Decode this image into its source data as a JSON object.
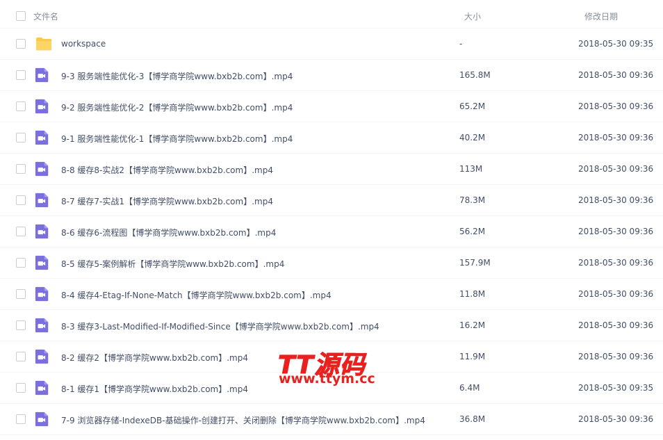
{
  "header": {
    "name_label": "文件名",
    "size_label": "大小",
    "date_label": "修改日期"
  },
  "files": [
    {
      "name": "workspace",
      "size": "-",
      "date": "2018-05-30 09:35",
      "type": "folder-icon"
    },
    {
      "name": "9-3 服务端性能优化-3【博学商学院www.bxb2b.com】.mp4",
      "size": "165.8M",
      "date": "2018-05-30 09:36",
      "type": "video-icon"
    },
    {
      "name": "9-2 服务端性能优化-2【博学商学院www.bxb2b.com】.mp4",
      "size": "65.2M",
      "date": "2018-05-30 09:36",
      "type": "video-icon"
    },
    {
      "name": "9-1 服务端性能优化-1【博学商学院www.bxb2b.com】.mp4",
      "size": "40.2M",
      "date": "2018-05-30 09:36",
      "type": "video-icon"
    },
    {
      "name": "8-8 缓存8-实战2【博学商学院www.bxb2b.com】.mp4",
      "size": "113M",
      "date": "2018-05-30 09:36",
      "type": "video-icon"
    },
    {
      "name": "8-7 缓存7-实战1【博学商学院www.bxb2b.com】.mp4",
      "size": "78.3M",
      "date": "2018-05-30 09:36",
      "type": "video-icon"
    },
    {
      "name": "8-6 缓存6-流程图【博学商学院www.bxb2b.com】.mp4",
      "size": "56.2M",
      "date": "2018-05-30 09:36",
      "type": "video-icon"
    },
    {
      "name": "8-5 缓存5-案例解析【博学商学院www.bxb2b.com】.mp4",
      "size": "157.9M",
      "date": "2018-05-30 09:36",
      "type": "video-icon"
    },
    {
      "name": "8-4 缓存4-Etag-If-None-Match【博学商学院www.bxb2b.com】.mp4",
      "size": "11.8M",
      "date": "2018-05-30 09:36",
      "type": "video-icon"
    },
    {
      "name": "8-3 缓存3-Last-Modified-If-Modified-Since【博学商学院www.bxb2b.com】.mp4",
      "size": "16.2M",
      "date": "2018-05-30 09:36",
      "type": "video-icon"
    },
    {
      "name": "8-2 缓存2【博学商学院www.bxb2b.com】.mp4",
      "size": "11.9M",
      "date": "2018-05-30 09:36",
      "type": "video-icon"
    },
    {
      "name": "8-1 缓存1【博学商学院www.bxb2b.com】.mp4",
      "size": "6.4M",
      "date": "2018-05-30 09:35",
      "type": "video-icon"
    },
    {
      "name": "7-9 浏览器存储-IndexeDB-基础操作-创建打开、关闭删除【博学商学院www.bxb2b.com】.mp4",
      "size": "36.8M",
      "date": "2018-05-30 09:36",
      "type": "video-icon"
    }
  ],
  "watermark": {
    "title": "TT源码",
    "url": "www.ttym.cc"
  },
  "colors": {
    "folder": "#fcc94e",
    "video": "#7b6fe0",
    "watermark": "#e8201e"
  }
}
